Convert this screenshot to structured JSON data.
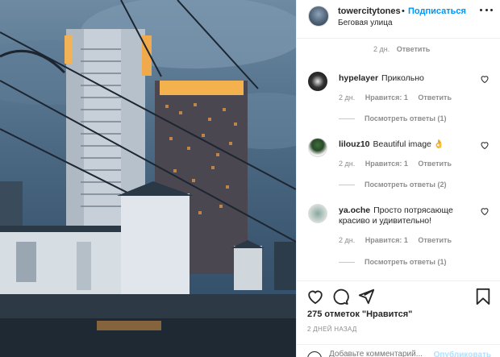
{
  "header": {
    "username": "towercitytones",
    "separator": "•",
    "follow_label": "Подписаться",
    "location": "Беговая улица"
  },
  "previous_comment_meta": {
    "time": "2 дн.",
    "reply_label": "Ответить"
  },
  "comments": [
    {
      "username": "hypelayer",
      "text": "Прикольно",
      "time": "2 дн.",
      "likes": "Нравится: 1",
      "reply_label": "Ответить",
      "view_replies": "Посмотреть ответы (1)"
    },
    {
      "username": "lilouz10",
      "text": "Beautiful image 👌",
      "time": "2 дн.",
      "likes": "Нравится: 1",
      "reply_label": "Ответить",
      "view_replies": "Посмотреть ответы (2)"
    },
    {
      "username": "ya.oche",
      "text": "Просто потрясающе красиво и удивительно!",
      "time": "2 дн.",
      "likes": "Нравится: 1",
      "reply_label": "Ответить",
      "view_replies": "Посмотреть ответы (1)"
    }
  ],
  "actions": {
    "like_icon": "heart-icon",
    "comment_icon": "comment-icon",
    "share_icon": "share-icon",
    "save_icon": "bookmark-icon"
  },
  "likes_count": "275 отметок \"Нравится\"",
  "timestamp": "2 ДНЕЙ НАЗАД",
  "comment_input": {
    "placeholder": "Добавьте комментарий...",
    "publish_label": "Опубликовать"
  },
  "colors": {
    "accent": "#0095f6",
    "publish_disabled": "#b2dffc",
    "muted": "#8e8e8e",
    "text": "#262626"
  }
}
